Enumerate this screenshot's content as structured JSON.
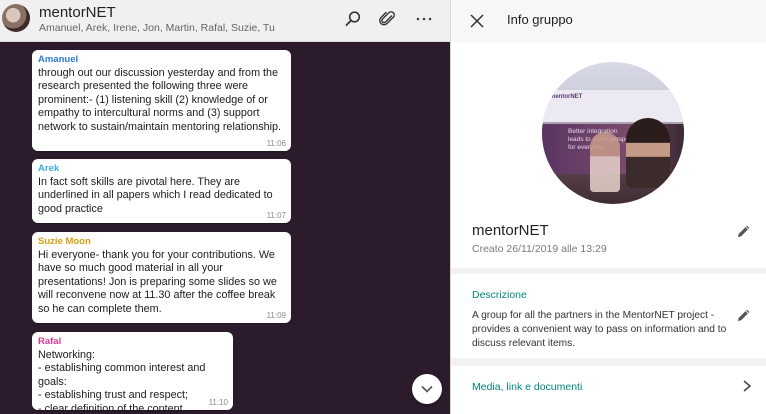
{
  "chat": {
    "title": "mentorNET",
    "members": "Amanuel, Arek, Irene, Jon, Martin, Rafal, Suzie, Tu",
    "messages": [
      {
        "author": "Amanuel",
        "author_color": "#2c7bd1",
        "text": "through out our discussion yesterday and from the research presented the following three were prominent:- (1) listening skill (2) knowledge of or empathy to intercultural norms and (3) support network to sustain/maintain mentoring relationship.",
        "time": "11:06"
      },
      {
        "author": "Arek",
        "author_color": "#3bafd9",
        "text": "In fact soft skills are pivotal here. They are underlined in all papers which I read dedicated to good practice",
        "time": "11:07"
      },
      {
        "author": "Suzie Moon",
        "author_color": "#d69e12",
        "text": "Hi everyone- thank you for your contributions.   We have so much good material in all your presentations!  Jon is preparing some slides so we will reconvene now at 11.30 after the coffee break so he can complete them.",
        "time": "11:09"
      },
      {
        "author": "Rafal",
        "author_color": "#d8369a",
        "text": "Networking:\n-  establishing common interest and goals:\n- establishing trust and respect;\n- clear definition of the content.",
        "time": "11:10"
      }
    ]
  },
  "info": {
    "header_title": "Info gruppo",
    "group_name": "mentorNET",
    "created": "Creato 26/11/2019 alle 13:29",
    "description_label": "Descrizione",
    "description": "A group for all the partners in the MentorNET project - provides a convenient way to pass on information and to discuss relevant items.",
    "media_label": "Media, link e documenti",
    "photo_logo": "mentorNET",
    "photo_caption_1": "Better integration",
    "photo_caption_2": "leads to more prosperity",
    "photo_caption_3": "for everyone"
  },
  "colors": {
    "chat_background": "#2b1b2d",
    "accent": "#00897b"
  },
  "icons": {
    "search": "search-icon",
    "attach": "paperclip-icon",
    "more": "more-icon",
    "close": "close-icon",
    "edit": "pencil-icon",
    "chevron": "chevron-right-icon",
    "scroll": "chevron-down-icon"
  }
}
